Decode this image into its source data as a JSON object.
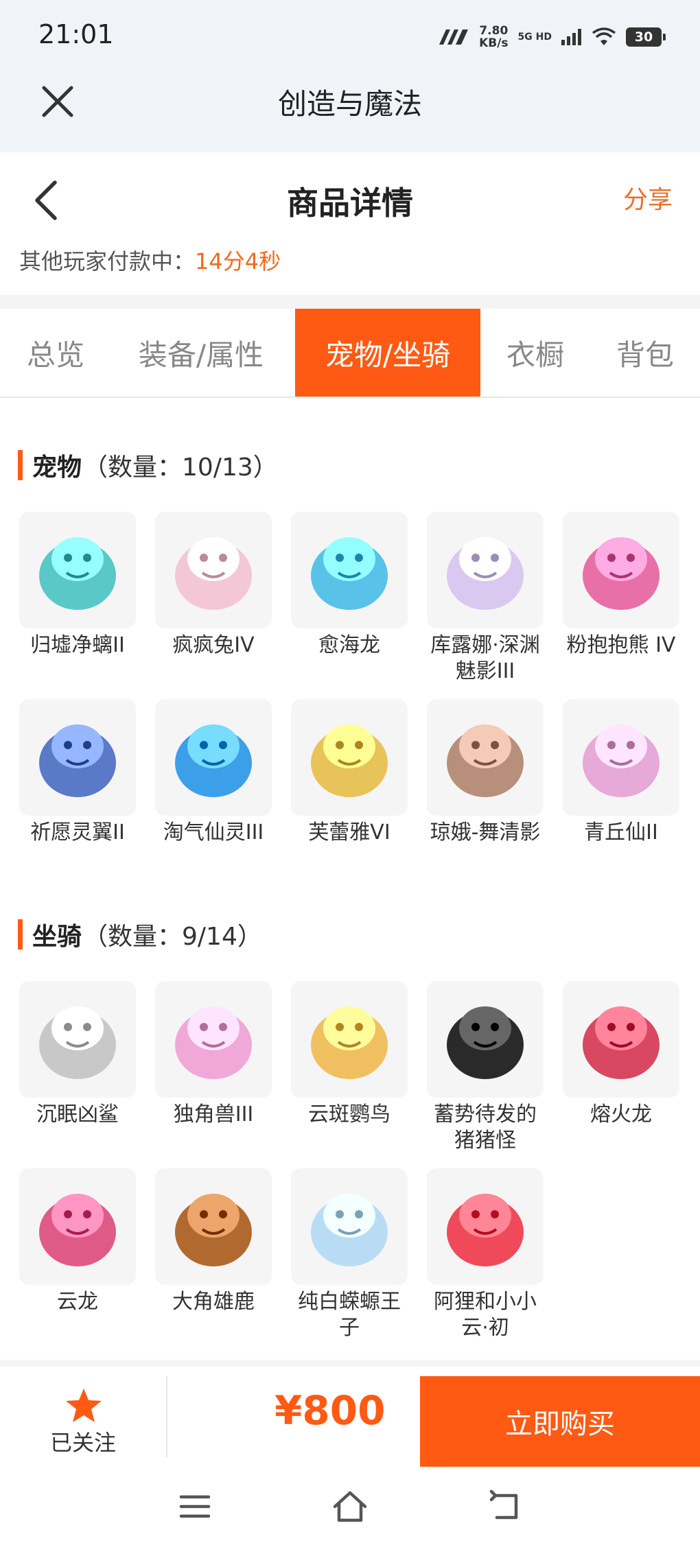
{
  "status_bar": {
    "time": "21:01",
    "speed_value": "7.80",
    "speed_unit": "KB/s",
    "network": "5G HD",
    "battery": "30"
  },
  "app_bar": {
    "title": "创造与魔法"
  },
  "header": {
    "title": "商品详情",
    "share": "分享",
    "paying_label": "其他玩家付款中：",
    "paying_timer": "14分4秒"
  },
  "tabs": [
    {
      "label": "总览",
      "active": false
    },
    {
      "label": "装备/属性",
      "active": false
    },
    {
      "label": "宠物/坐骑",
      "active": true
    },
    {
      "label": "衣橱",
      "active": false
    },
    {
      "label": "背包",
      "active": false
    }
  ],
  "pets": {
    "title": "宠物",
    "count": "（数量：10/13）",
    "items": [
      {
        "name": "归墟净螭II",
        "icon": "sea-dragon-icon",
        "color": "#5bc8c8"
      },
      {
        "name": "疯疯兔IV",
        "icon": "rabbit-icon",
        "color": "#f4c7d6"
      },
      {
        "name": "愈海龙",
        "icon": "ice-dragon-icon",
        "color": "#58c2e8"
      },
      {
        "name": "库露娜·深渊魅影III",
        "icon": "fairy-icon",
        "color": "#d9c8f0"
      },
      {
        "name": "粉抱抱熊 IV",
        "icon": "bear-icon",
        "color": "#e96fa8"
      },
      {
        "name": "祈愿灵翼II",
        "icon": "eagle-icon",
        "color": "#5a7ac8"
      },
      {
        "name": "淘气仙灵III",
        "icon": "puppy-icon",
        "color": "#3ca0e8"
      },
      {
        "name": "芙蕾雅VI",
        "icon": "goddess-icon",
        "color": "#e8c35a"
      },
      {
        "name": "琼娥-舞清影",
        "icon": "dancer-icon",
        "color": "#b88f7a"
      },
      {
        "name": "青丘仙II",
        "icon": "fox-fairy-icon",
        "color": "#e6a9d8"
      }
    ]
  },
  "mounts": {
    "title": "坐骑",
    "count": "（数量：9/14）",
    "items": [
      {
        "name": "沉眠凶鲨",
        "icon": "shark-icon",
        "color": "#c8c8c8"
      },
      {
        "name": "独角兽III",
        "icon": "unicorn-icon",
        "color": "#f0a8d8"
      },
      {
        "name": "云斑鹦鸟",
        "icon": "parrot-icon",
        "color": "#f0c060"
      },
      {
        "name": "蓄势待发的猪猪怪",
        "icon": "pig-icon",
        "color": "#2a2a2a"
      },
      {
        "name": "熔火龙",
        "icon": "fire-dragon-icon",
        "color": "#d84860"
      },
      {
        "name": "云龙",
        "icon": "cloud-dragon-icon",
        "color": "#e05a88"
      },
      {
        "name": "大角雄鹿",
        "icon": "stag-icon",
        "color": "#b06a30"
      },
      {
        "name": "纯白蝾螈王子",
        "icon": "axolotl-icon",
        "color": "#b8dcf4"
      },
      {
        "name": "阿狸和小小云·初",
        "icon": "ahri-cloud-icon",
        "color": "#f04a5a"
      }
    ]
  },
  "bottom": {
    "follow_label": "已关注",
    "price": "¥800",
    "buy_label": "立即购买"
  },
  "colors": {
    "accent": "#ff5a14",
    "timer": "#f26a1b"
  }
}
